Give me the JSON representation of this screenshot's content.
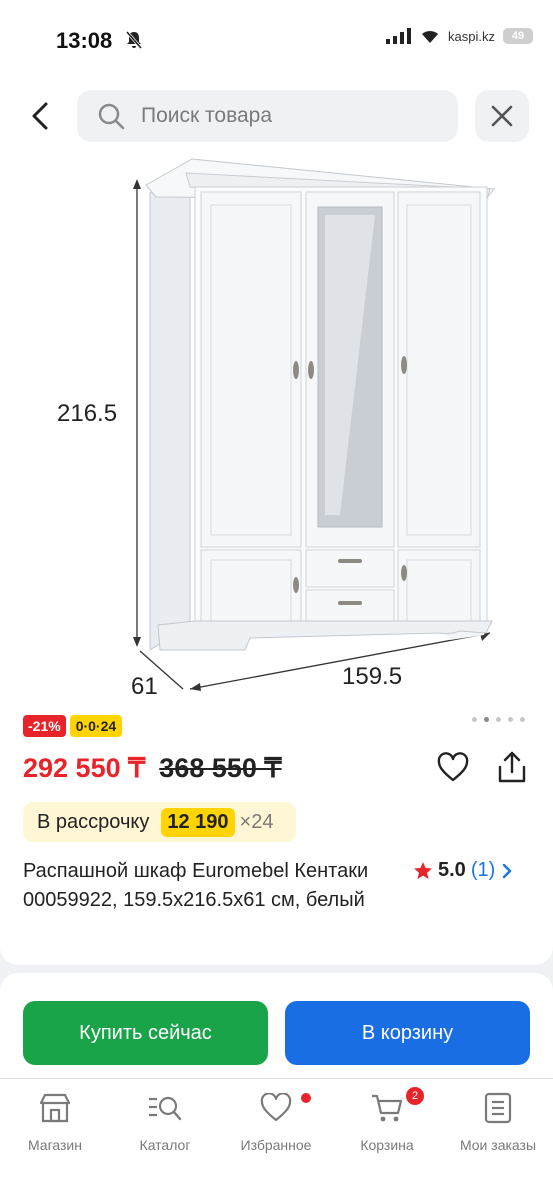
{
  "status": {
    "time": "13:08",
    "site": "kaspi.kz",
    "battery": "49"
  },
  "search": {
    "placeholder": "Поиск товара"
  },
  "product": {
    "dimensions": {
      "height": "216.5",
      "width": "159.5",
      "depth": "61"
    },
    "badges": {
      "discount": "-21%",
      "plan": "0·0·24"
    },
    "price_current": "292 550 ₸",
    "price_old": "368 550 ₸",
    "installment": {
      "label": "В рассрочку",
      "amount": "12 190",
      "multiplier": "×24"
    },
    "title": "Распашной шкаф Euromebel Кентаки 00059922, 159.5x216.5x61 см, белый",
    "rating": {
      "value": "5.0",
      "count": "(1)"
    },
    "gallery": {
      "total": 5,
      "active": 2
    }
  },
  "actions": {
    "buy": "Купить сейчас",
    "cart": "В корзину"
  },
  "tabs": [
    {
      "label": "Магазин",
      "icon": "shop-icon"
    },
    {
      "label": "Каталог",
      "icon": "catalog-search-icon"
    },
    {
      "label": "Избранное",
      "icon": "heart-icon"
    },
    {
      "label": "Корзина",
      "icon": "cart-icon",
      "badge": "2"
    },
    {
      "label": "Мои заказы",
      "icon": "orders-icon"
    }
  ],
  "colors": {
    "accent_red": "#e8242b",
    "buy_green": "#1aa44a",
    "cart_blue": "#1a6ee3",
    "badge_yellow": "#ffd400"
  }
}
